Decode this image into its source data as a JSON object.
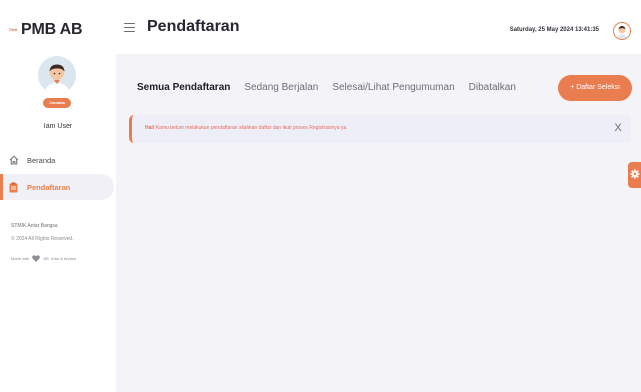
{
  "brand": {
    "mark": "=⁍⁍",
    "name": "PMB AB"
  },
  "user": {
    "role": "Camaba",
    "name": "Iam User"
  },
  "sidebar": {
    "items": [
      {
        "label": "Beranda",
        "icon": "home-icon"
      },
      {
        "label": "Pendaftaran",
        "icon": "clipboard-icon"
      }
    ],
    "footer": {
      "institution": "STMIK Antar Bangsa",
      "copyright": "© 2024 All Rights Reserved.",
      "made_with_prefix": "Made with",
      "made_with_suffix": "AR, Irfan & Annisa"
    }
  },
  "header": {
    "title": "Pendaftaran",
    "datetime": "Saturday, 25 May 2024 13:41:35"
  },
  "tabs": [
    {
      "label": "Semua Pendaftaran",
      "active": true
    },
    {
      "label": "Sedang Berjalan",
      "active": false
    },
    {
      "label": "Selesai/Lihat Pengumuman",
      "active": false
    },
    {
      "label": "Dibatalkan",
      "active": false
    }
  ],
  "actions": {
    "add_label": "+ Daftar Seleksi"
  },
  "alert": {
    "strong": "Hai!",
    "message": " Kamu belum melakukan pendaftaran silahkan daftar dan ikuti proses Registrasinya ya",
    "close": "X"
  },
  "colors": {
    "accent": "#ea7d4f",
    "alert_text": "#e96b5d",
    "background": "#f4f3f7",
    "sidebar_active_bg": "#f1f0f6"
  }
}
